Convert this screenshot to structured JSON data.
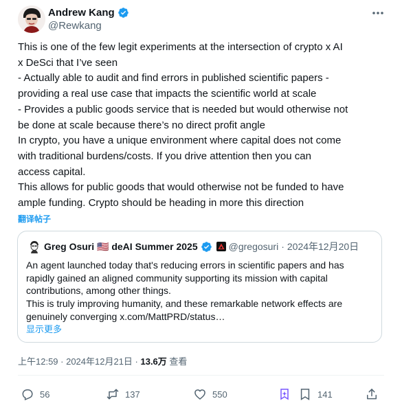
{
  "post": {
    "author": {
      "display_name": "Andrew Kang",
      "handle": "@Rewkang",
      "verified_icon": "verified-badge-icon"
    },
    "more_icon": "more-options-icon",
    "body_lines": [
      "This is one of the few legit experiments at the intersection of crypto x AI",
      "x DeSci that I’ve seen",
      "- Actually able to audit and find errors in published scientific papers -",
      "providing a real use case that impacts the scientific world at scale",
      "- Provides a public goods service that is needed but would otherwise not",
      "be done at scale because there’s no direct profit angle",
      "In crypto, you have a unique environment where capital does not come",
      "with traditional burdens/costs. If you drive attention then you can",
      "access capital.",
      "This allows for public goods that would otherwise not be funded to have",
      "ample funding. Crypto should be heading in more this direction"
    ],
    "translate_label": "翻译帖子",
    "quote": {
      "display_name": "Greg Osuri 🇺🇸 deAI Summer 2025",
      "handle": "@gregosuri",
      "separator": "·",
      "date": "2024年12月20日",
      "text_lines": [
        "An agent launched today that's reducing errors in scientific papers and has",
        "rapidly gained an aligned community supporting its mission with capital",
        "contributions, among other things.",
        "This is truly improving humanity, and these remarkable network effects are",
        "genuinely converging x.com/MattPRD/status…"
      ],
      "show_more": "显示更多"
    },
    "timestamp": {
      "time_date": "上午12:59 · 2024年12月21日 · ",
      "views": "13.6万",
      "views_label": " 查看"
    },
    "actions": {
      "replies": "56",
      "reposts": "137",
      "likes": "550",
      "bookmarks": "141"
    },
    "colors": {
      "accent": "#1d9bf0",
      "secondary_text": "#536471",
      "primary_text": "#0f1419",
      "border": "#cfd9de"
    }
  }
}
